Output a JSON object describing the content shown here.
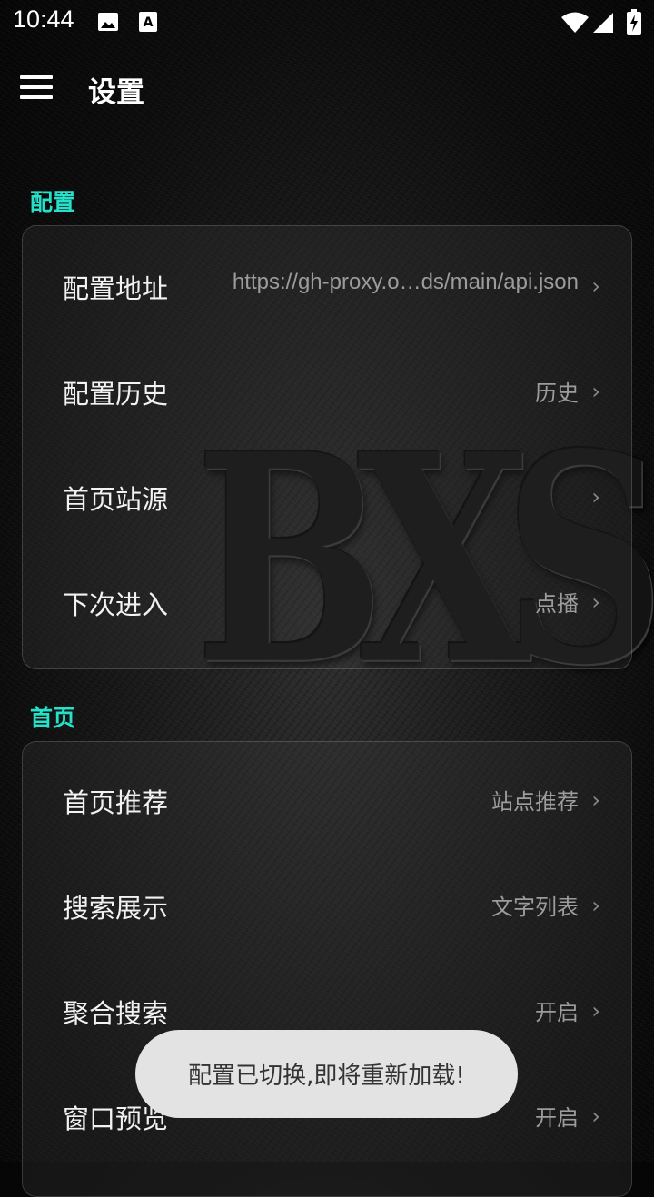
{
  "status_bar": {
    "time": "10:44",
    "icons": [
      "image-icon",
      "font-icon",
      "wifi-icon",
      "signal-icon",
      "battery-icon"
    ]
  },
  "app_bar": {
    "title": "设置",
    "menu_icon": "menu-icon"
  },
  "watermark": "BXS",
  "sections": {
    "config": {
      "title": "配置",
      "items": [
        {
          "label": "配置地址",
          "value": "https://gh-proxy.o…ds/main/api.json"
        },
        {
          "label": "配置历史",
          "value": "历史"
        },
        {
          "label": "首页站源",
          "value": ""
        },
        {
          "label": "下次进入",
          "value": "点播"
        }
      ]
    },
    "home": {
      "title": "首页",
      "items": [
        {
          "label": "首页推荐",
          "value": "站点推荐"
        },
        {
          "label": "搜索展示",
          "value": "文字列表"
        },
        {
          "label": "聚合搜索",
          "value": "开启"
        },
        {
          "label": "窗口预览",
          "value": "开启"
        }
      ]
    }
  },
  "chevron": "›",
  "toast": "配置已切换,即将重新加载!",
  "colors": {
    "accent": "#27e0c9",
    "toast_bg": "#e3e3e3"
  }
}
